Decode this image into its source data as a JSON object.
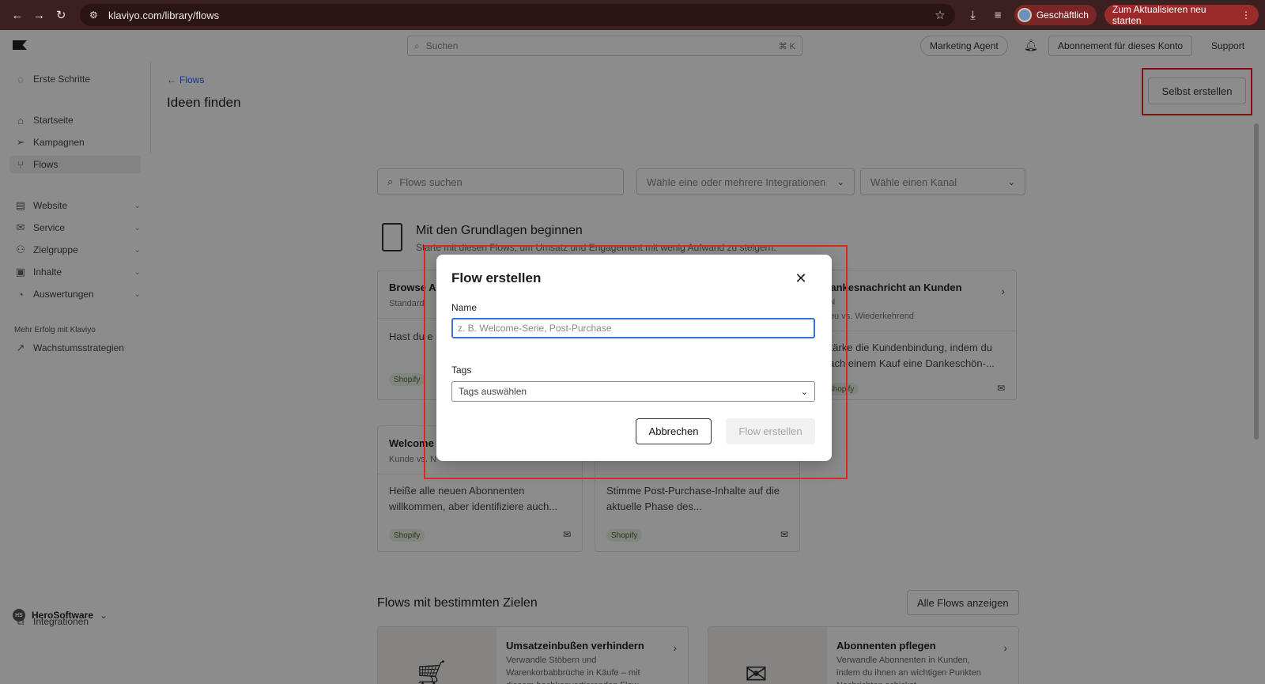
{
  "browser": {
    "url": "klaviyo.com/library/flows",
    "profile_label": "Geschäftlich",
    "update_label": "Zum Aktualisieren neu starten"
  },
  "topbar": {
    "search_placeholder": "Suchen",
    "search_shortcut": "⌘ K",
    "marketing_agent": "Marketing Agent",
    "subscription": "Abonnement für dieses Konto",
    "support": "Support"
  },
  "sidebar": {
    "getting_started": "Erste Schritte",
    "items": [
      {
        "label": "Startseite",
        "icon": "home-icon"
      },
      {
        "label": "Kampagnen",
        "icon": "send-icon"
      },
      {
        "label": "Flows",
        "icon": "flows-icon"
      },
      {
        "label": "Website",
        "icon": "website-icon"
      },
      {
        "label": "Service",
        "icon": "service-icon"
      },
      {
        "label": "Zielgruppe",
        "icon": "audience-icon"
      },
      {
        "label": "Inhalte",
        "icon": "content-icon"
      },
      {
        "label": "Auswertungen",
        "icon": "analytics-icon"
      }
    ],
    "more_caption": "Mehr Erfolg mit Klaviyo",
    "growth": "Wachstumsstrategien",
    "integrations": "Integrationen",
    "account_name": "HeroSoftware",
    "account_badge": "HS"
  },
  "main": {
    "back_link": "Flows",
    "title": "Ideen finden",
    "build_button": "Selbst erstellen",
    "filters": {
      "search_placeholder": "Flows suchen",
      "integrations": "Wähle eine oder mehrere Integrationen",
      "channel": "Wähle einen Kanal"
    },
    "basics_title": "Mit den Grundlagen beginnen",
    "basics_subtitle": "Starte mit diesen Flows, um Umsatz und Engagement mit wenig Aufwand zu steigern.",
    "cards": [
      {
        "title": "Browse Al",
        "sub": "Standard",
        "desc": "Hast du e gefällt? M",
        "tag": "Shopify"
      },
      {
        "title": "Dankesnachricht an Kunden",
        "sub_lang": "EN",
        "sub": "Neu vs. Wiederkehrend",
        "desc": "Stärke die Kundenbindung, indem du nach einem Kauf eine Dankeschön-...",
        "tag": "Shopify"
      },
      {
        "title": "Welcome",
        "sub": "Kunde vs. N",
        "desc": "Heiße alle neuen Abonnenten willkommen, aber identifiziere auch...",
        "tag": "Shopify"
      },
      {
        "title": "",
        "sub": "",
        "desc": "Stimme Post-Purchase-Inhalte auf die aktuelle Phase des...",
        "tag": "Shopify"
      }
    ],
    "goals_title": "Flows mit bestimmten Zielen",
    "all_flows_button": "Alle Flows anzeigen",
    "goals": [
      {
        "title": "Umsatzeinbußen verhindern",
        "desc": "Verwandle Stöbern und Warenkorbabbrüche in Käufe – mit diesem hochkonvertierenden Flow."
      },
      {
        "title": "Abonnenten pflegen",
        "desc": "Verwandle Abonnenten in Kunden, indem du ihnen an wichtigen Punkten Nachrichten schickst."
      }
    ]
  },
  "modal": {
    "title": "Flow erstellen",
    "name_label": "Name",
    "name_placeholder": "z. B. Welcome-Serie, Post-Purchase",
    "tags_label": "Tags",
    "tags_placeholder": "Tags auswählen",
    "cancel": "Abbrechen",
    "create": "Flow erstellen"
  },
  "colors": {
    "chrome_bg": "#3c1f1f",
    "accent_blue": "#3a6fd8",
    "highlight_red": "#e0261e"
  }
}
